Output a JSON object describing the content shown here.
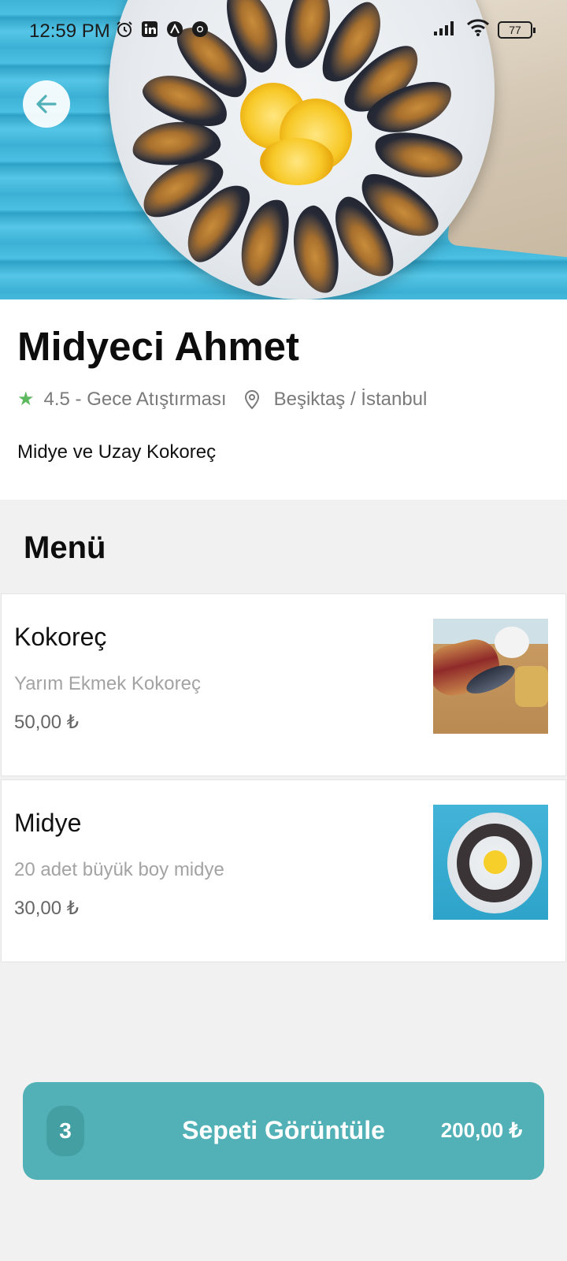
{
  "status_bar": {
    "time": "12:59 PM",
    "battery": "77",
    "left_icons": [
      "alarm-icon",
      "linkedin-icon",
      "app-icon",
      "chrome-icon"
    ],
    "right_icons": [
      "signal-icon",
      "wifi-icon",
      "battery-icon"
    ]
  },
  "restaurant": {
    "name": "Midyeci Ahmet",
    "rating_category": "4.5 - Gece Atıştırması",
    "location": "Beşiktaş / İstanbul",
    "description": "Midye ve Uzay Kokoreç"
  },
  "menu": {
    "heading": "Menü",
    "items": [
      {
        "name": "Kokoreç",
        "description": "Yarım Ekmek Kokoreç",
        "price": "50,00 ₺"
      },
      {
        "name": "Midye",
        "description": "20 adet büyük boy midye",
        "price": "30,00 ₺"
      }
    ]
  },
  "cart": {
    "count": "3",
    "label": "Sepeti Görüntüle",
    "total": "200,00 ₺"
  },
  "colors": {
    "accent": "#52b1b6",
    "rating_star": "#5cb85c",
    "back_arrow": "#52b1b6"
  }
}
